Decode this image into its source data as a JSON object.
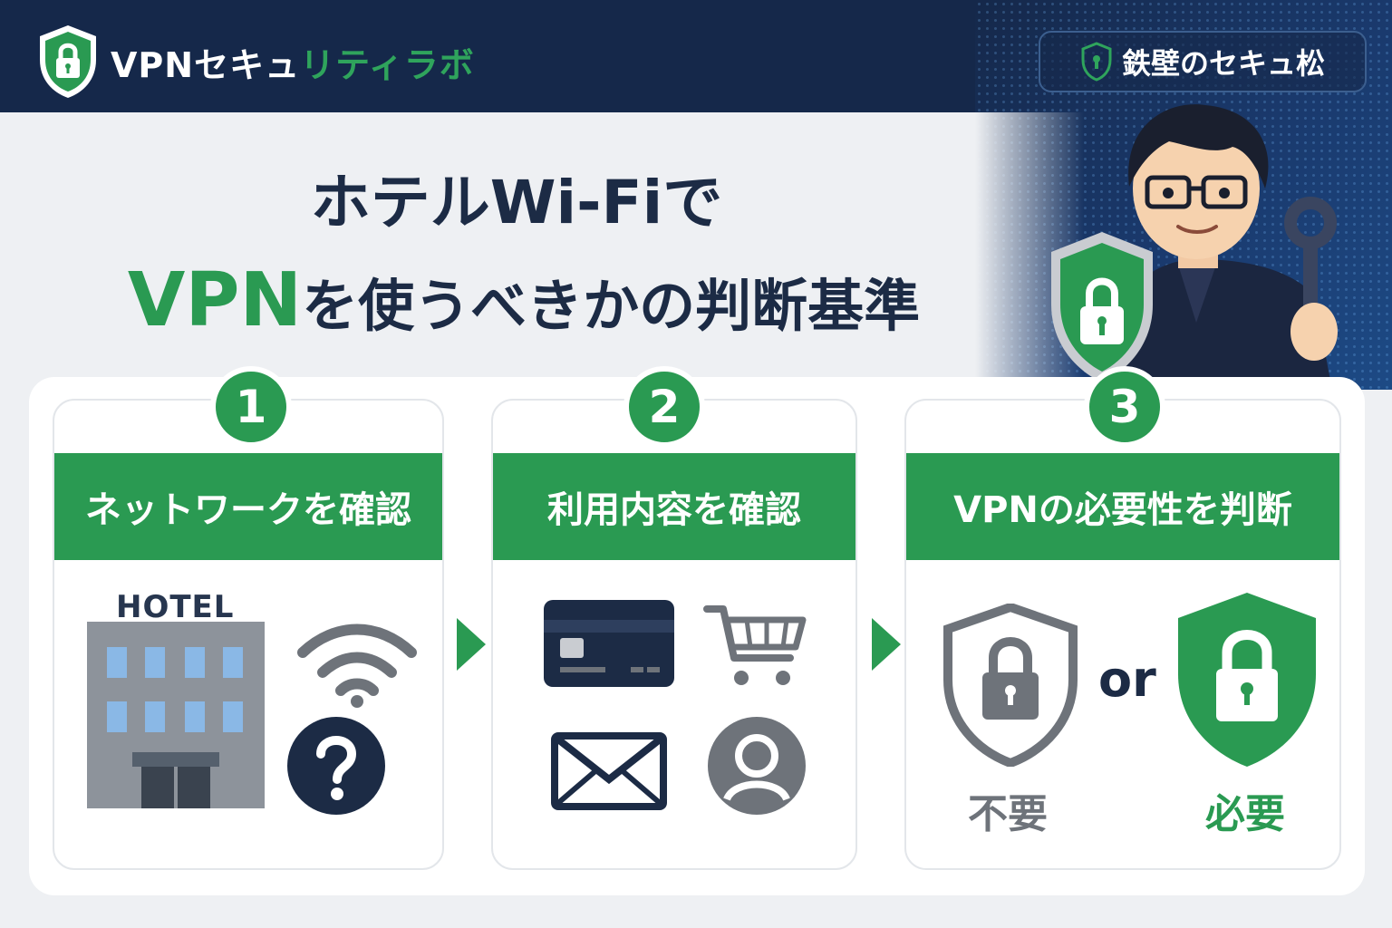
{
  "header": {
    "logo_white": "VPNセキュ",
    "logo_green": "リティラボ",
    "badge_label": "鉄壁のセキュ松"
  },
  "title": {
    "line1": "ホテルWi-Fiで",
    "line2_accent": "VPN",
    "line2_rest": "を使うべきかの判断基準"
  },
  "steps": [
    {
      "number": "1",
      "label": "ネットワークを確認"
    },
    {
      "number": "2",
      "label": "利用内容を確認"
    },
    {
      "number": "3",
      "label": "VPNの必要性を判断"
    }
  ],
  "step1": {
    "hotel_sign": "HOTEL"
  },
  "step3": {
    "or_text": "or",
    "option_a": "不要",
    "option_b": "必要"
  },
  "colors": {
    "navy": "#15284a",
    "green": "#2a9a52",
    "gray": "#6e737a",
    "dark": "#1c2b45"
  },
  "icons": [
    "shield-lock-icon",
    "hotel-building-icon",
    "wifi-icon",
    "question-icon",
    "credit-card-icon",
    "shopping-cart-icon",
    "mail-icon",
    "user-icon",
    "arrow-right-icon"
  ]
}
